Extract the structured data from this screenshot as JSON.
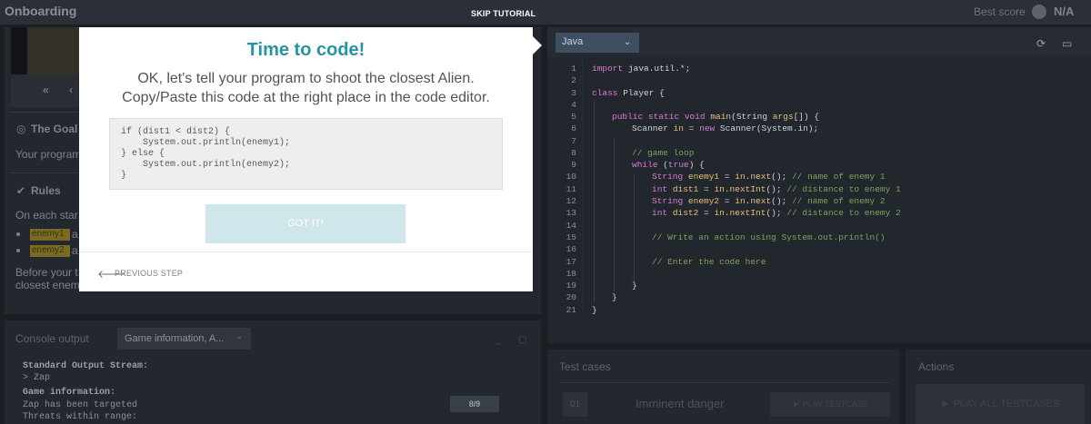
{
  "topbar": {
    "title": "Onboarding",
    "skip_label": "SKIP TUTORIAL",
    "best_score_label": "Best score",
    "best_score_value": "N/A"
  },
  "left": {
    "controls": [
      "«",
      "‹"
    ],
    "goal_heading": "The Goal",
    "goal_text": "Your program",
    "rules_heading": "Rules",
    "rules_text": "On each star",
    "chip1": "enemy1",
    "chip1_tail": "a",
    "chip2": "enemy2",
    "chip2_tail": "a",
    "before_text": "Before your t",
    "closest_text": "closest enem"
  },
  "console": {
    "title": "Console output",
    "select_value": "Game information, A...",
    "lines": [
      {
        "text": "Standard Output Stream:",
        "bold": true
      },
      {
        "text": "> Zap",
        "bold": false
      },
      {
        "text": "Game information:",
        "bold": true
      },
      {
        "text": "Zap has been targeted",
        "bold": false
      },
      {
        "text": "Threats within range:",
        "bold": false
      }
    ],
    "progress": "8/9"
  },
  "editor": {
    "language": "Java",
    "line_numbers": [
      "1",
      "2",
      "3",
      "4",
      "5",
      "6",
      "7",
      "8",
      "9",
      "10",
      "11",
      "12",
      "13",
      "14",
      "15",
      "16",
      "17",
      "18",
      "19",
      "20",
      "21"
    ]
  },
  "modal": {
    "title": "Time to code!",
    "text_line1": "OK, let's tell your program to shoot the closest Alien.",
    "text_line2": "Copy/Paste this code at the right place in the code editor.",
    "snippet": [
      "if (dist1 < dist2) {",
      "    System.out.println(enemy1);",
      "} else {",
      "    System.out.println(enemy2);",
      "}"
    ],
    "got_it_label": "GOT IT!",
    "previous_label": "PREVIOUS STEP"
  },
  "tests": {
    "title": "Test cases",
    "case_number": "01",
    "case_name": "Imminent danger",
    "play_label": "► PLAY TESTCASE"
  },
  "actions": {
    "title": "Actions",
    "play_all_label": "► PLAY ALL TESTCASES"
  },
  "colors": {
    "accent": "#2594a3",
    "background": "#1b1f24",
    "panel": "#23282f",
    "highlight_chip": "#7a6a23"
  },
  "icons": {
    "best_score": "score-icon",
    "refresh": "refresh-icon",
    "fullscreen": "fullscreen-icon",
    "back": "arrow-left-icon"
  }
}
